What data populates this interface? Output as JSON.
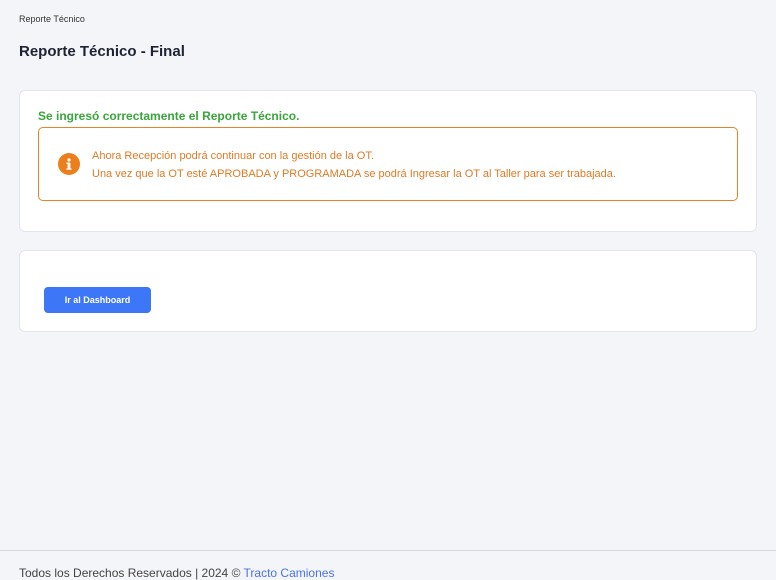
{
  "breadcrumb": {
    "current": "Reporte Técnico"
  },
  "page": {
    "title": "Reporte Técnico - Final"
  },
  "result": {
    "success_message": "Se ingresó correctamente el Reporte Técnico.",
    "alert": {
      "icon": "info-icon",
      "line1": "Ahora Recepción podrá continuar con la gestión de la OT.",
      "line2": "Una vez que la OT esté APROBADA y PROGRAMADA se podrá Ingresar la OT al Taller para ser trabajada."
    }
  },
  "actions": {
    "dashboard_label": "Ir al Dashboard"
  },
  "footer": {
    "text": "Todos los Derechos Reservados  | 2024 © ",
    "link_label": "Tracto Camiones"
  },
  "colors": {
    "success": "#3aa53a",
    "warning": "#ec7f1c",
    "primary": "#3d77f7",
    "link": "#4a72e8"
  }
}
